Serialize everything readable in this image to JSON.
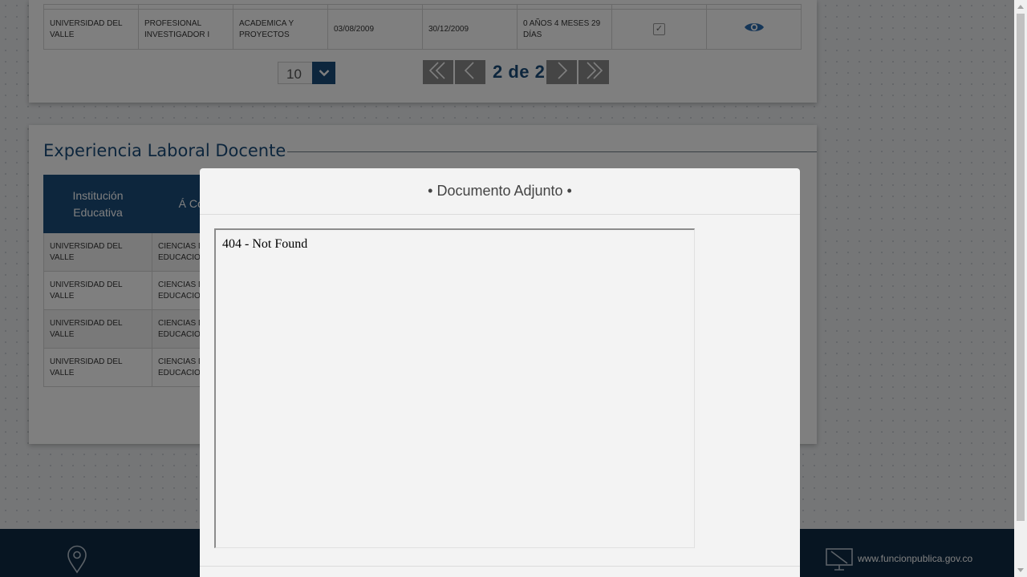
{
  "experience_table": {
    "row": [
      "UNIVERSIDAD DEL VALLE",
      "PROFESIONAL INVESTIGADOR I",
      "ACADEMICA Y PROYECTOS",
      "03/08/2009",
      "30/12/2009",
      "0 AÑOS 4 MESES 29 DÍAS"
    ]
  },
  "pagination": {
    "page_size": "10",
    "page_text": "2 de 2"
  },
  "teaching_section": {
    "title": "Experiencia Laboral Docente",
    "headers": [
      "Institución Educativa",
      "Á Conoc"
    ],
    "rows": [
      [
        "UNIVERSIDAD DEL VALLE",
        "CIENCIAS D EDUCACIO"
      ],
      [
        "UNIVERSIDAD DEL VALLE",
        "CIENCIAS D EDUCACIO"
      ],
      [
        "UNIVERSIDAD DEL VALLE",
        "CIENCIAS D EDUCACIO"
      ],
      [
        "UNIVERSIDAD DEL VALLE",
        "CIENCIAS D EDUCACIO"
      ]
    ]
  },
  "modal": {
    "title": "• Documento Adjunto •",
    "frame_message": "404 - Not Found"
  },
  "footer": {
    "website": "www.funcionpublica.gov.co"
  },
  "icons": [
    "checkbox-checked-icon",
    "eye-icon",
    "chevron-down-icon",
    "double-chevron-left-icon",
    "chevron-left-icon",
    "chevron-right-icon",
    "double-chevron-right-icon",
    "location-pin-icon",
    "computer-icon"
  ],
  "colors": {
    "primary_blue": "#1b4c7a",
    "footer_bg": "#0f2a44",
    "pager_gray": "#8a8a8a"
  }
}
